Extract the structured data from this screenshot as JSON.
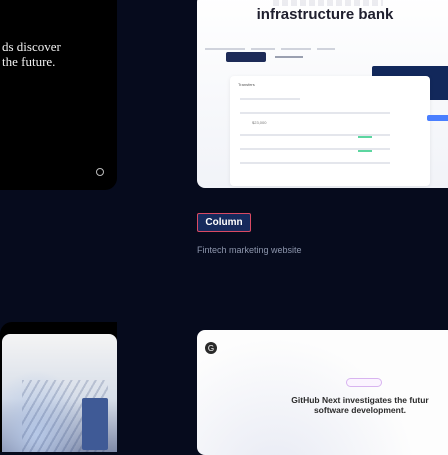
{
  "top_left_card": {
    "headline_line1": "ds discover",
    "headline_line2": "the future."
  },
  "top_right_card": {
    "title": "infrastructure bank",
    "panel_label": "Transfers",
    "panel_amount": "$23,000"
  },
  "column_annotation": {
    "chip_label": "Column",
    "caption": "Fintech marketing website"
  },
  "bottom_right_card": {
    "logo_glyph": "G",
    "article_line1": "GitHub Next investigates the futur",
    "article_line2": "software development."
  },
  "colors": {
    "page_background": "#060b1d",
    "chip_background": "#162a5c",
    "chip_border": "#d94a63",
    "caption_text": "#8d96ad"
  }
}
